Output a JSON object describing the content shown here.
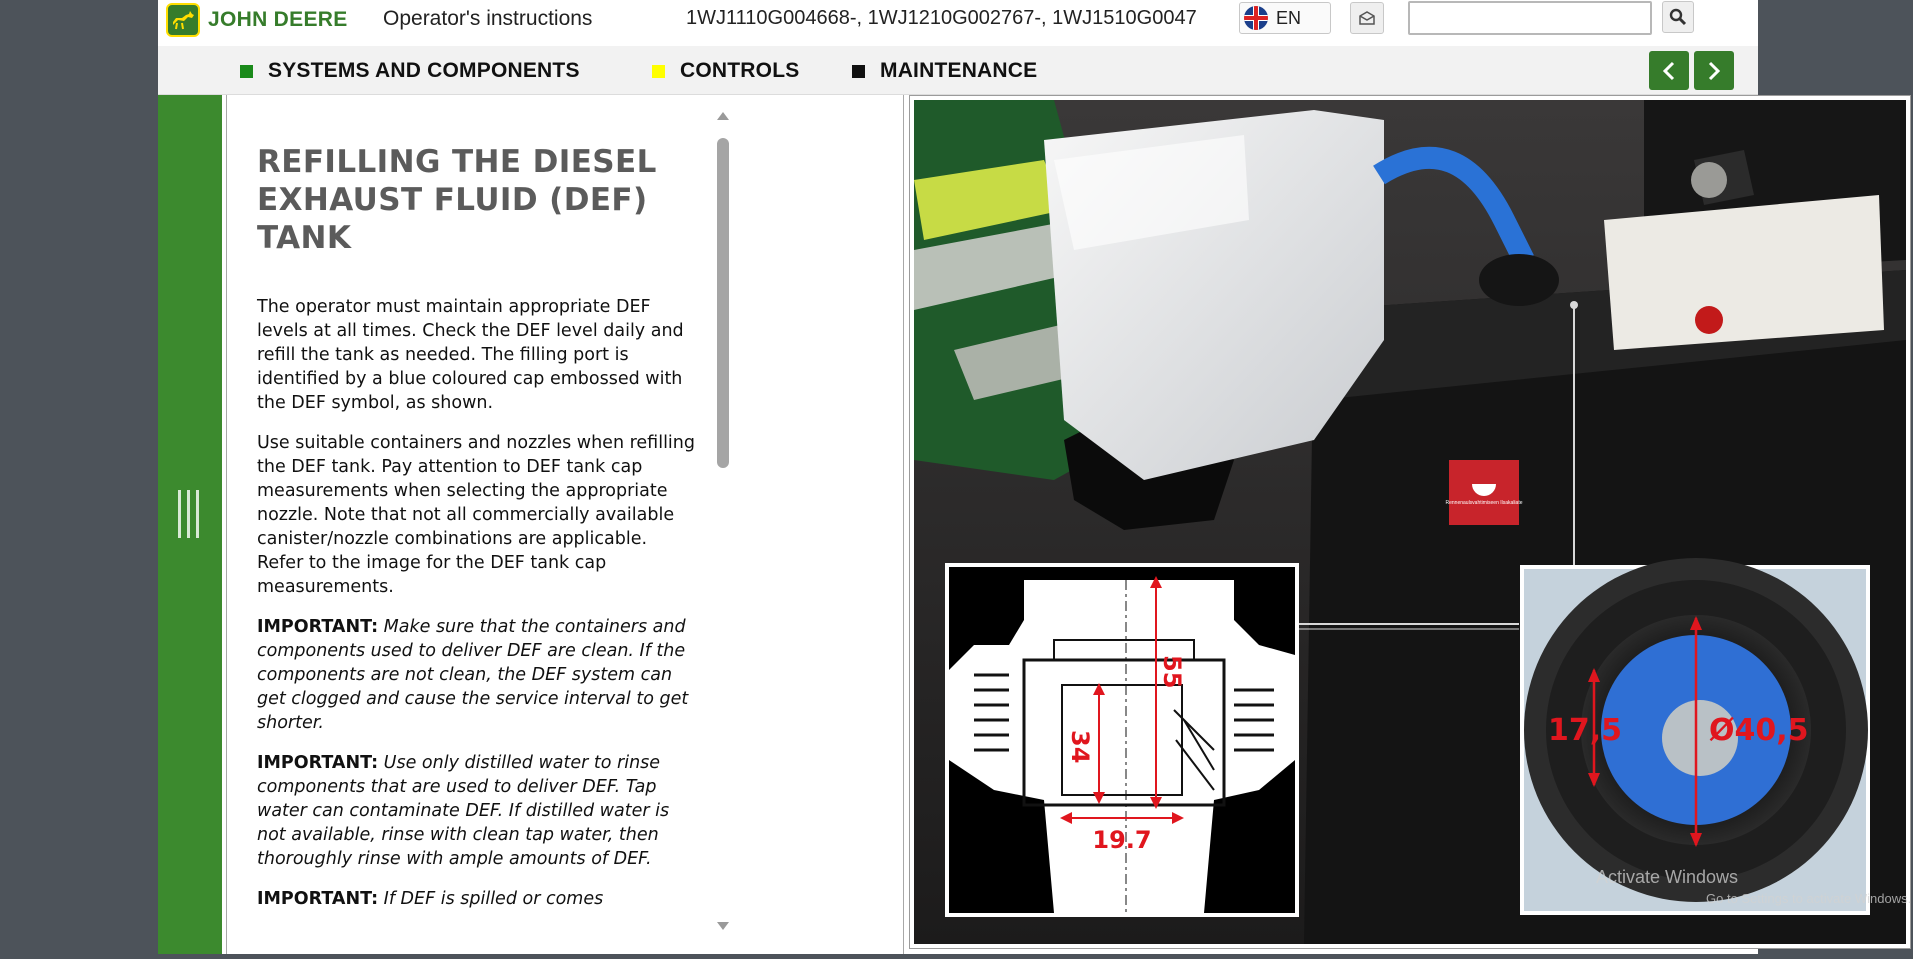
{
  "header": {
    "brand": "JOHN DEERE",
    "doc_title": "Operator's instructions",
    "serials": "1WJ1110G004668-, 1WJ1210G002767-, 1WJ1510G0047",
    "language": "EN",
    "search_value": ""
  },
  "nav": {
    "items": [
      {
        "label": "SYSTEMS AND COMPONENTS",
        "color": "#1a8a1a"
      },
      {
        "label": "CONTROLS",
        "color": "#ffff00"
      },
      {
        "label": "MAINTENANCE",
        "color": "#111111"
      }
    ]
  },
  "content": {
    "title": "REFILLING THE DIESEL EXHAUST FLUID (DEF) TANK",
    "p1": "The operator must maintain appropriate DEF levels at all times. Check the DEF level daily and refill the tank as needed. The filling port is identified by a blue coloured cap embossed with the DEF symbol, as shown.",
    "p2": "Use suitable containers and nozzles when refilling the DEF tank. Pay attention to DEF tank cap measurements when selecting the appropriate nozzle. Note that not all commercially available canister/nozzle combinations are applicable. Refer to the image for the DEF tank cap measurements.",
    "imp1_label": "IMPORTANT:",
    "imp1_text": "Make sure that the containers and components used to deliver DEF are clean. If the components are not clean, the DEF system can get clogged and cause the service interval to get shorter.",
    "imp2_label": "IMPORTANT:",
    "imp2_text": "Use only distilled water to rinse components that are used to deliver DEF. Tap water can contaminate DEF. If distilled water is not available, rinse with clean tap water, then thoroughly rinse with ample amounts of DEF.",
    "imp3_label": "IMPORTANT:",
    "imp3_text": "If DEF is spilled or comes"
  },
  "figure": {
    "dim_height": "55",
    "dim_inner": "34",
    "dim_width": "19.7",
    "cap_depth": "17,5",
    "cap_diameter": "Ø40,5",
    "sticker_text": "Rennenaulsvahtimiseen Ilsakaliate"
  },
  "watermark": {
    "line1": "Activate Windows",
    "line2": "Go to Settings to activate Windows."
  },
  "colors": {
    "brand_green": "#367c2b",
    "brand_yellow": "#ffde00",
    "rail_green": "#3c8a2e",
    "dimension_red": "#e0161e",
    "cap_blue": "#2f6fd4"
  }
}
